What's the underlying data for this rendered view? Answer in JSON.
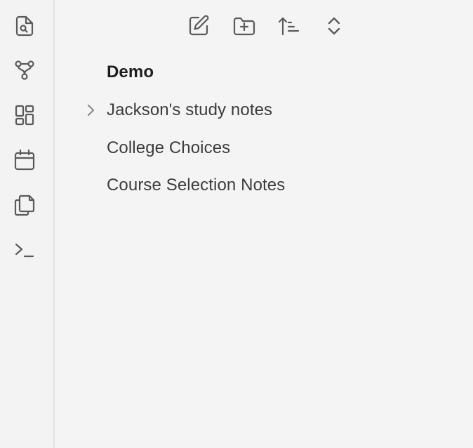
{
  "ribbon": {
    "items": [
      {
        "name": "quick-switcher",
        "icon": "file-search-icon"
      },
      {
        "name": "graph-view",
        "icon": "graph-icon"
      },
      {
        "name": "canvas",
        "icon": "dashboard-icon"
      },
      {
        "name": "daily-note",
        "icon": "calendar-icon"
      },
      {
        "name": "templates",
        "icon": "copy-icon"
      },
      {
        "name": "command-palette",
        "icon": "terminal-icon"
      }
    ]
  },
  "nav": {
    "buttons": [
      {
        "name": "new-note",
        "icon": "edit-icon"
      },
      {
        "name": "new-folder",
        "icon": "folder-plus-icon"
      },
      {
        "name": "sort",
        "icon": "sort-icon"
      },
      {
        "name": "collapse-all",
        "icon": "chevrons-up-down-icon"
      }
    ]
  },
  "vault": {
    "name": "Demo",
    "items": [
      {
        "label": "Jackson's study notes",
        "type": "folder",
        "collapsed": true
      },
      {
        "label": "College Choices",
        "type": "file"
      },
      {
        "label": "Course Selection Notes",
        "type": "file"
      }
    ]
  },
  "colors": {
    "background": "#f3f3f3",
    "icon": "#5a5a5a",
    "text": "#3c3c3c",
    "divider": "#e2e2e2"
  }
}
